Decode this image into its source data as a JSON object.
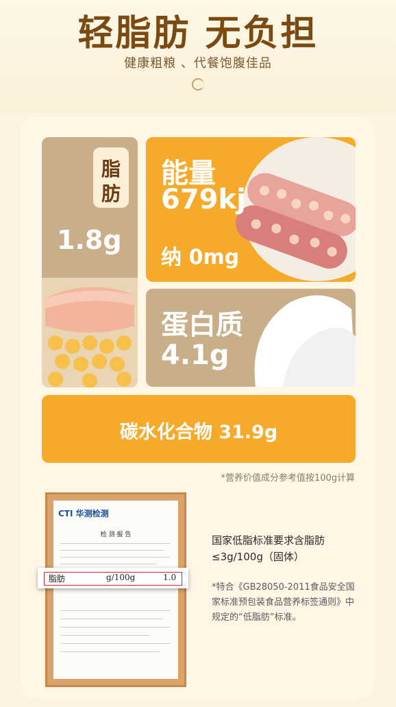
{
  "header": {
    "title": "轻脂肪 无负担",
    "subtitle": "健康粗粮 、代餐饱腹佳品"
  },
  "nutrition": {
    "fat_label_line1": "脂",
    "fat_label_line2": "肪",
    "fat_value": "1.8g",
    "energy_label": "能量",
    "energy_value": "679kj",
    "sodium": "纳 0mg",
    "protein_label": "蛋白质",
    "protein_value": "4.1g",
    "carb": "碳水化合物 31.9g",
    "note": "*营养价值成分参考值按100g计算"
  },
  "report": {
    "brand": "CTI 华测检测",
    "title": "检 测 报 告",
    "row_item": "脂肪",
    "row_unit": "g/100g",
    "row_value": "1.0"
  },
  "standard": {
    "main": "国家低脂标准要求含脂肪≤3g/100g（固体）",
    "note": "*特合《GB28050-2011食品安全国家标准预包装食品营养标签通则》中规定的“低脂肪”标准。"
  },
  "colors": {
    "orange": "#f7a92a",
    "tan": "#c9ae8a",
    "brown": "#7a4a12"
  }
}
